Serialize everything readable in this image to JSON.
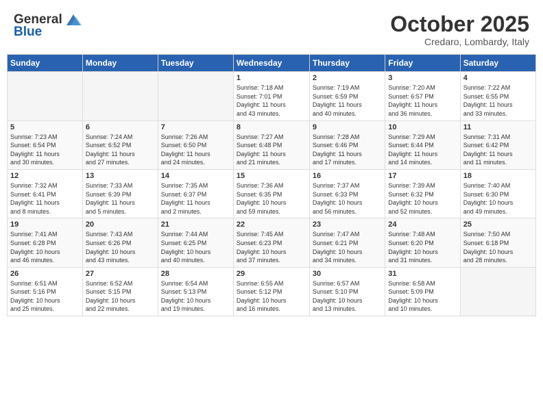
{
  "header": {
    "logo_line1": "General",
    "logo_line2": "Blue",
    "month": "October 2025",
    "location": "Credaro, Lombardy, Italy"
  },
  "weekdays": [
    "Sunday",
    "Monday",
    "Tuesday",
    "Wednesday",
    "Thursday",
    "Friday",
    "Saturday"
  ],
  "weeks": [
    [
      {
        "day": "",
        "info": ""
      },
      {
        "day": "",
        "info": ""
      },
      {
        "day": "",
        "info": ""
      },
      {
        "day": "1",
        "info": "Sunrise: 7:18 AM\nSunset: 7:01 PM\nDaylight: 11 hours\nand 43 minutes."
      },
      {
        "day": "2",
        "info": "Sunrise: 7:19 AM\nSunset: 6:59 PM\nDaylight: 11 hours\nand 40 minutes."
      },
      {
        "day": "3",
        "info": "Sunrise: 7:20 AM\nSunset: 6:57 PM\nDaylight: 11 hours\nand 36 minutes."
      },
      {
        "day": "4",
        "info": "Sunrise: 7:22 AM\nSunset: 6:55 PM\nDaylight: 11 hours\nand 33 minutes."
      }
    ],
    [
      {
        "day": "5",
        "info": "Sunrise: 7:23 AM\nSunset: 6:54 PM\nDaylight: 11 hours\nand 30 minutes."
      },
      {
        "day": "6",
        "info": "Sunrise: 7:24 AM\nSunset: 6:52 PM\nDaylight: 11 hours\nand 27 minutes."
      },
      {
        "day": "7",
        "info": "Sunrise: 7:26 AM\nSunset: 6:50 PM\nDaylight: 11 hours\nand 24 minutes."
      },
      {
        "day": "8",
        "info": "Sunrise: 7:27 AM\nSunset: 6:48 PM\nDaylight: 11 hours\nand 21 minutes."
      },
      {
        "day": "9",
        "info": "Sunrise: 7:28 AM\nSunset: 6:46 PM\nDaylight: 11 hours\nand 17 minutes."
      },
      {
        "day": "10",
        "info": "Sunrise: 7:29 AM\nSunset: 6:44 PM\nDaylight: 11 hours\nand 14 minutes."
      },
      {
        "day": "11",
        "info": "Sunrise: 7:31 AM\nSunset: 6:42 PM\nDaylight: 11 hours\nand 11 minutes."
      }
    ],
    [
      {
        "day": "12",
        "info": "Sunrise: 7:32 AM\nSunset: 6:41 PM\nDaylight: 11 hours\nand 8 minutes."
      },
      {
        "day": "13",
        "info": "Sunrise: 7:33 AM\nSunset: 6:39 PM\nDaylight: 11 hours\nand 5 minutes."
      },
      {
        "day": "14",
        "info": "Sunrise: 7:35 AM\nSunset: 6:37 PM\nDaylight: 11 hours\nand 2 minutes."
      },
      {
        "day": "15",
        "info": "Sunrise: 7:36 AM\nSunset: 6:35 PM\nDaylight: 10 hours\nand 59 minutes."
      },
      {
        "day": "16",
        "info": "Sunrise: 7:37 AM\nSunset: 6:33 PM\nDaylight: 10 hours\nand 56 minutes."
      },
      {
        "day": "17",
        "info": "Sunrise: 7:39 AM\nSunset: 6:32 PM\nDaylight: 10 hours\nand 52 minutes."
      },
      {
        "day": "18",
        "info": "Sunrise: 7:40 AM\nSunset: 6:30 PM\nDaylight: 10 hours\nand 49 minutes."
      }
    ],
    [
      {
        "day": "19",
        "info": "Sunrise: 7:41 AM\nSunset: 6:28 PM\nDaylight: 10 hours\nand 46 minutes."
      },
      {
        "day": "20",
        "info": "Sunrise: 7:43 AM\nSunset: 6:26 PM\nDaylight: 10 hours\nand 43 minutes."
      },
      {
        "day": "21",
        "info": "Sunrise: 7:44 AM\nSunset: 6:25 PM\nDaylight: 10 hours\nand 40 minutes."
      },
      {
        "day": "22",
        "info": "Sunrise: 7:45 AM\nSunset: 6:23 PM\nDaylight: 10 hours\nand 37 minutes."
      },
      {
        "day": "23",
        "info": "Sunrise: 7:47 AM\nSunset: 6:21 PM\nDaylight: 10 hours\nand 34 minutes."
      },
      {
        "day": "24",
        "info": "Sunrise: 7:48 AM\nSunset: 6:20 PM\nDaylight: 10 hours\nand 31 minutes."
      },
      {
        "day": "25",
        "info": "Sunrise: 7:50 AM\nSunset: 6:18 PM\nDaylight: 10 hours\nand 28 minutes."
      }
    ],
    [
      {
        "day": "26",
        "info": "Sunrise: 6:51 AM\nSunset: 5:16 PM\nDaylight: 10 hours\nand 25 minutes."
      },
      {
        "day": "27",
        "info": "Sunrise: 6:52 AM\nSunset: 5:15 PM\nDaylight: 10 hours\nand 22 minutes."
      },
      {
        "day": "28",
        "info": "Sunrise: 6:54 AM\nSunset: 5:13 PM\nDaylight: 10 hours\nand 19 minutes."
      },
      {
        "day": "29",
        "info": "Sunrise: 6:55 AM\nSunset: 5:12 PM\nDaylight: 10 hours\nand 16 minutes."
      },
      {
        "day": "30",
        "info": "Sunrise: 6:57 AM\nSunset: 5:10 PM\nDaylight: 10 hours\nand 13 minutes."
      },
      {
        "day": "31",
        "info": "Sunrise: 6:58 AM\nSunset: 5:09 PM\nDaylight: 10 hours\nand 10 minutes."
      },
      {
        "day": "",
        "info": ""
      }
    ]
  ]
}
